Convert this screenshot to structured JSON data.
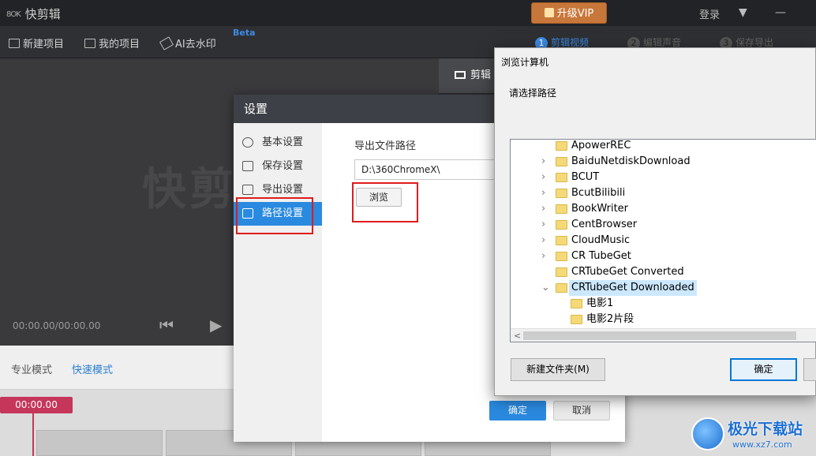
{
  "app": {
    "logo_prefix": "8OK",
    "title": "快剪辑",
    "vip_label": "升级VIP",
    "login_label": "登录",
    "dropdown_icon": "▼",
    "minimize_icon": "—"
  },
  "toolbar": {
    "new_project": "新建项目",
    "my_projects": "我的项目",
    "ai_watermark": "AI去水印",
    "beta": "Beta"
  },
  "steps": [
    {
      "num": "1",
      "label": "剪辑视频"
    },
    {
      "num": "2",
      "label": "编辑声音"
    },
    {
      "num": "3",
      "label": "保存导出"
    }
  ],
  "editor": {
    "watermark_text": "快剪",
    "timecode": "00:00.00/00:00.00",
    "tab_label": "剪辑",
    "mode_pro": "专业模式",
    "mode_fast": "快速模式",
    "marker_time": "00:00.00"
  },
  "settings": {
    "title": "设置",
    "menu": [
      {
        "label": "基本设置"
      },
      {
        "label": "保存设置"
      },
      {
        "label": "导出设置"
      },
      {
        "label": "路径设置"
      }
    ],
    "path_label": "导出文件路径",
    "path_value": "D:\\360ChromeX\\",
    "browse_label": "浏览",
    "ok_label": "确定",
    "cancel_label": "取消"
  },
  "browse": {
    "title": "浏览计算机",
    "prompt": "请选择路径",
    "folders": [
      {
        "name": "ApowerREC",
        "expandable": false,
        "level": 0
      },
      {
        "name": "BaiduNetdiskDownload",
        "expandable": true,
        "level": 0
      },
      {
        "name": "BCUT",
        "expandable": true,
        "level": 0
      },
      {
        "name": "BcutBilibili",
        "expandable": true,
        "level": 0
      },
      {
        "name": "BookWriter",
        "expandable": true,
        "level": 0
      },
      {
        "name": "CentBrowser",
        "expandable": true,
        "level": 0
      },
      {
        "name": "CloudMusic",
        "expandable": true,
        "level": 0
      },
      {
        "name": "CR TubeGet",
        "expandable": true,
        "level": 0
      },
      {
        "name": "CRTubeGet Converted",
        "expandable": false,
        "level": 0
      },
      {
        "name": "CRTubeGet Downloaded",
        "expandable": true,
        "expanded": true,
        "selected": true,
        "level": 0
      },
      {
        "name": "电影1",
        "expandable": false,
        "level": 1
      },
      {
        "name": "电影2片段",
        "expandable": false,
        "level": 1
      }
    ],
    "new_folder_label": "新建文件夹(M)",
    "confirm_label": "确定"
  },
  "site_mark": {
    "name": "极光下载站",
    "url": "www.xz7.com"
  }
}
